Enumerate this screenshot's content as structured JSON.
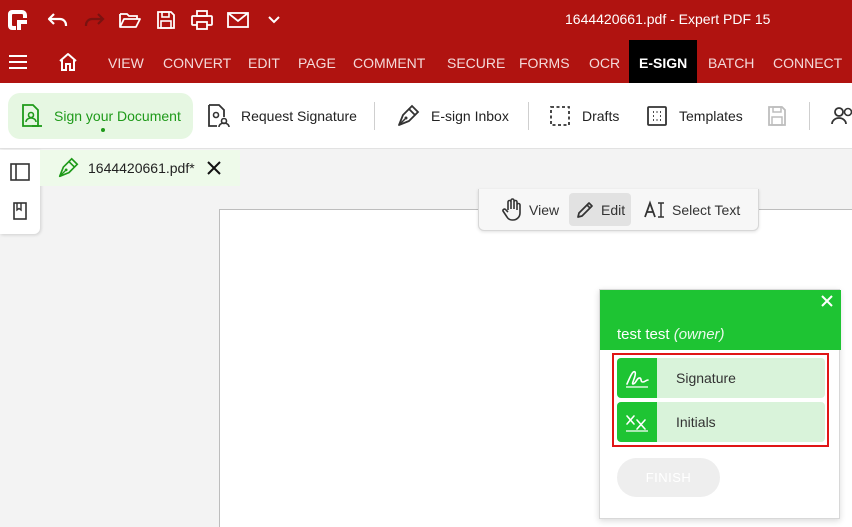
{
  "titlebar": {
    "title": "1644420661.pdf  -  Expert PDF 15",
    "quick_access": [
      "app-logo-icon",
      "undo-icon",
      "redo-icon",
      "open-folder-icon",
      "save-icon",
      "print-icon",
      "email-icon",
      "chevron-down-icon"
    ]
  },
  "menu": {
    "tabs": [
      "VIEW",
      "CONVERT",
      "EDIT",
      "PAGE",
      "COMMENT",
      "SECURE",
      "FORMS",
      "OCR",
      "E-SIGN",
      "BATCH",
      "CONNECT"
    ],
    "active": "E-SIGN"
  },
  "ribbon": {
    "sign_your_document": "Sign your Document",
    "request_signature": "Request Signature",
    "esign_inbox": "E-sign Inbox",
    "drafts": "Drafts",
    "templates": "Templates"
  },
  "document_tab": {
    "name": "1644420661.pdf*"
  },
  "modes": {
    "view": "View",
    "edit": "Edit",
    "select_text": "Select Text",
    "selected": "Edit"
  },
  "sign_panel": {
    "signer_name": "test test",
    "signer_role": "(owner)",
    "signature_label": "Signature",
    "initials_label": "Initials",
    "finish_label": "FINISH"
  },
  "colors": {
    "titlebar": "#b01310",
    "active_tab": "#000000",
    "accent_green": "#1ec433",
    "ribbon_active_bg": "#e6f7e2",
    "field_bg": "#d9f3da",
    "highlight_border": "#e01515"
  }
}
